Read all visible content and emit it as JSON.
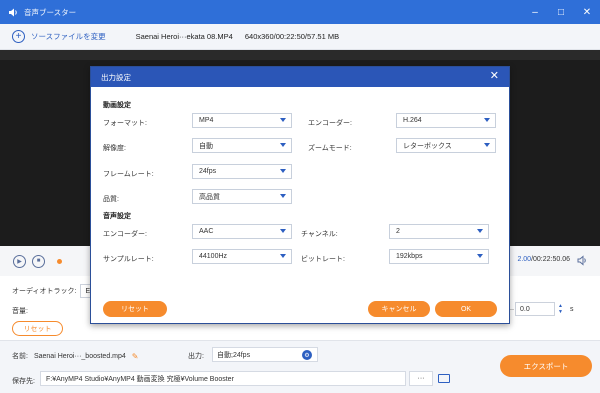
{
  "window": {
    "title": "音声ブースター",
    "controls": [
      "minimize",
      "maximize",
      "close"
    ]
  },
  "toolbar": {
    "add_label": "ソースファイルを変更",
    "file_name": "Saenai Heroi···ekata 08.MP4",
    "file_meta": "640x360/00:22:50/57.51 MB"
  },
  "playback": {
    "time_current": "2.00",
    "time_total": "/00:22:50.06"
  },
  "audio_track": {
    "label": "オーディオトラック:",
    "value": "EN-A"
  },
  "volume": {
    "label": "音量:",
    "delay_value": "0.0",
    "unit": "s"
  },
  "reset_small_label": "リセット",
  "bottom": {
    "name_label": "名前:",
    "file_name": "Saenai Heroi···_boosted.mp4",
    "output_label": "出力:",
    "output_value": "自動;24fps",
    "save_label": "保存先:",
    "save_path": "F:¥AnyMP4 Studio¥AnyMP4 動画変換 究極¥Volume Booster",
    "browse_label": "···",
    "export_label": "エクスポート"
  },
  "dialog": {
    "title": "出力設定",
    "video_section": "動画設定",
    "audio_section": "音声設定",
    "format_label": "フォーマット:",
    "format_value": "MP4",
    "video_encoder_label": "エンコーダー:",
    "video_encoder_value": "H.264",
    "resolution_label": "解像度:",
    "resolution_value": "自動",
    "zoom_label": "ズームモード:",
    "zoom_value": "レターボックス",
    "framerate_label": "フレームレート:",
    "framerate_value": "24fps",
    "quality_label": "品質:",
    "quality_value": "高品質",
    "audio_encoder_label": "エンコーダー:",
    "audio_encoder_value": "AAC",
    "channel_label": "チャンネル:",
    "channel_value": "2",
    "samplerate_label": "サンプルレート:",
    "samplerate_value": "44100Hz",
    "bitrate_label": "ビットレート:",
    "bitrate_value": "192kbps",
    "reset_label": "リセット",
    "cancel_label": "キャンセル",
    "ok_label": "OK"
  },
  "colors": {
    "titlebar": "#2f6fd8",
    "dialog_header": "#2b56b7",
    "accent_orange": "#f68b2d",
    "accent_blue": "#2d5fc1"
  }
}
